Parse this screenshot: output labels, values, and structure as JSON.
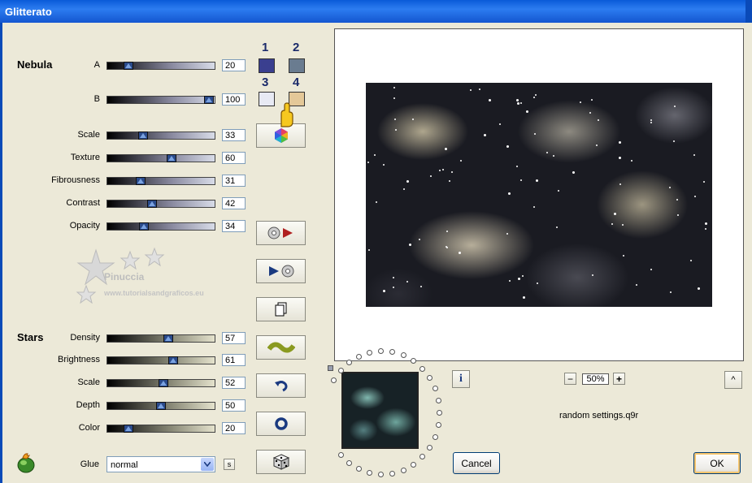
{
  "window": {
    "title": "Glitterato"
  },
  "nebula": {
    "section_label": "Nebula",
    "sliders": [
      {
        "label": "A",
        "value": "20",
        "pos": 0.2
      },
      {
        "label": "B",
        "value": "100",
        "pos": 0.95
      },
      {
        "label": "Scale",
        "value": "33",
        "pos": 0.33
      },
      {
        "label": "Texture",
        "value": "60",
        "pos": 0.6
      },
      {
        "label": "Fibrousness",
        "value": "31",
        "pos": 0.31
      },
      {
        "label": "Contrast",
        "value": "42",
        "pos": 0.42
      },
      {
        "label": "Opacity",
        "value": "34",
        "pos": 0.34
      }
    ]
  },
  "stars": {
    "section_label": "Stars",
    "sliders": [
      {
        "label": "Density",
        "value": "57",
        "pos": 0.57
      },
      {
        "label": "Brightness",
        "value": "61",
        "pos": 0.61
      },
      {
        "label": "Scale",
        "value": "52",
        "pos": 0.52
      },
      {
        "label": "Depth",
        "value": "50",
        "pos": 0.5
      },
      {
        "label": "Color",
        "value": "20",
        "pos": 0.2
      }
    ]
  },
  "swatches": [
    {
      "number": "1",
      "color": "#3a3f8f"
    },
    {
      "number": "2",
      "color": "#6a7c90"
    },
    {
      "number": "3",
      "color": "#e8eaf4"
    },
    {
      "number": "4",
      "color": "#e4c898"
    }
  ],
  "tool_buttons": [
    {
      "icon": "color-wheel-icon"
    },
    {
      "icon": "load-preset-icon"
    },
    {
      "icon": "save-preset-icon"
    },
    {
      "icon": "copy-icon"
    },
    {
      "icon": "wave-icon"
    },
    {
      "icon": "undo-icon"
    },
    {
      "icon": "reset-icon"
    },
    {
      "icon": "random-dice-icon"
    }
  ],
  "watermark": {
    "text": "Pinuccia",
    "url": "www.tutorialsandgraficos.eu"
  },
  "glue": {
    "label": "Glue",
    "value": "normal",
    "s_label": "s"
  },
  "zoom": {
    "value": "50%",
    "minus": "−",
    "plus": "+"
  },
  "info_button": {
    "label": "i"
  },
  "collapse_button": {
    "label": "^"
  },
  "status_text": "random settings.q9r",
  "buttons": {
    "cancel": "Cancel",
    "ok": "OK"
  }
}
